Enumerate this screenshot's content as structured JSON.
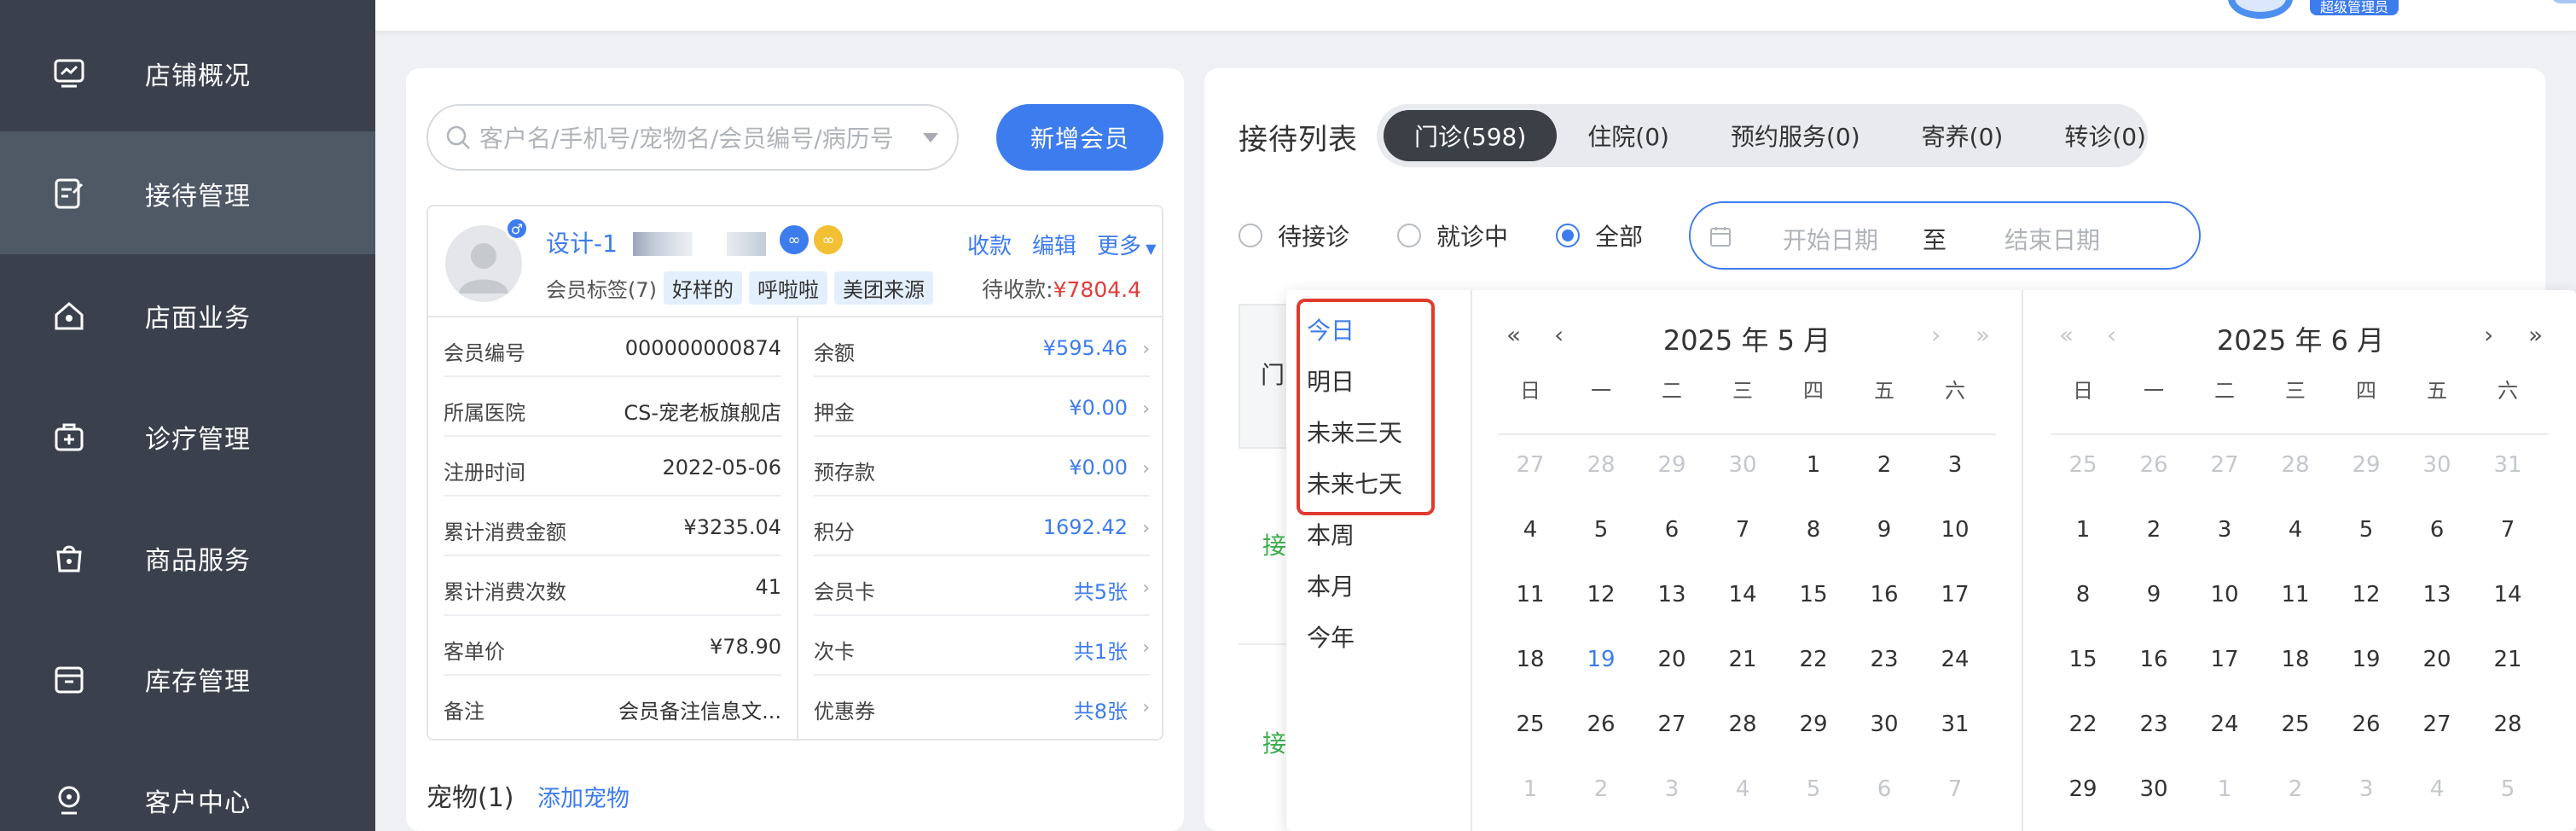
{
  "sidebar": {
    "items": [
      {
        "label": "店铺概况",
        "icon": "dashboard-icon",
        "active": false
      },
      {
        "label": "接待管理",
        "icon": "reception-icon",
        "active": true
      },
      {
        "label": "店面业务",
        "icon": "store-icon",
        "active": false
      },
      {
        "label": "诊疗管理",
        "icon": "medical-kit-icon",
        "active": false
      },
      {
        "label": "商品服务",
        "icon": "shopping-bag-icon",
        "active": false
      },
      {
        "label": "库存管理",
        "icon": "inventory-box-icon",
        "active": false
      },
      {
        "label": "客户中心",
        "icon": "customer-icon",
        "active": false
      }
    ]
  },
  "header": {
    "role_badge": "超级管理员"
  },
  "search": {
    "placeholder": "客户名/手机号/宠物名/会员编号/病历号",
    "add_member_label": "新增会员"
  },
  "member": {
    "name": "设计-1",
    "tags_label": "会员标签(7)",
    "tags": [
      "好样的",
      "呼啦啦",
      "美团来源"
    ],
    "actions": {
      "collect": "收款",
      "edit": "编辑",
      "more": "更多"
    },
    "due_label": "待收款:",
    "due_value": "¥7804.4",
    "left_rows": [
      {
        "k": "会员编号",
        "v": "000000000874"
      },
      {
        "k": "所属医院",
        "v": "CS-宠老板旗舰店"
      },
      {
        "k": "注册时间",
        "v": "2022-05-06"
      },
      {
        "k": "累计消费金额",
        "v": "¥3235.04"
      },
      {
        "k": "累计消费次数",
        "v": "41"
      },
      {
        "k": "客单价",
        "v": "¥78.90"
      },
      {
        "k": "备注",
        "v": "会员备注信息文..."
      }
    ],
    "right_rows": [
      {
        "k": "余额",
        "v": "¥595.46"
      },
      {
        "k": "押金",
        "v": "¥0.00"
      },
      {
        "k": "预存款",
        "v": "¥0.00"
      },
      {
        "k": "积分",
        "v": "1692.42"
      },
      {
        "k": "会员卡",
        "v": "共5张"
      },
      {
        "k": "次卡",
        "v": "共1张"
      },
      {
        "k": "优惠券",
        "v": "共8张"
      }
    ]
  },
  "pets": {
    "title": "宠物(1)",
    "add_label": "添加宠物"
  },
  "reception": {
    "title": "接待列表",
    "tabs": [
      {
        "label": "门诊(598)",
        "active": true
      },
      {
        "label": "住院(0)",
        "active": false
      },
      {
        "label": "预约服务(0)",
        "active": false
      },
      {
        "label": "寄养(0)",
        "active": false
      },
      {
        "label": "转诊(0)",
        "active": false
      }
    ],
    "status_filters": [
      {
        "label": "待接诊",
        "selected": false
      },
      {
        "label": "就诊中",
        "selected": false
      },
      {
        "label": "全部",
        "selected": true
      }
    ],
    "date_range": {
      "start_placeholder": "开始日期",
      "separator": "至",
      "end_placeholder": "结束日期"
    },
    "table_head_text": "门",
    "row_text": "接"
  },
  "date_picker": {
    "shortcuts": [
      "今日",
      "明日",
      "未来三天",
      "未来七天",
      "本周",
      "本月",
      "今年"
    ],
    "active_shortcut": "今日",
    "weekdays": [
      "日",
      "一",
      "二",
      "三",
      "四",
      "五",
      "六"
    ],
    "left_month": {
      "title": "2025 年 5 月",
      "days": [
        [
          27,
          28,
          29,
          30,
          1,
          2,
          3
        ],
        [
          4,
          5,
          6,
          7,
          8,
          9,
          10
        ],
        [
          11,
          12,
          13,
          14,
          15,
          16,
          17
        ],
        [
          18,
          19,
          20,
          21,
          22,
          23,
          24
        ],
        [
          25,
          26,
          27,
          28,
          29,
          30,
          31
        ],
        [
          1,
          2,
          3,
          4,
          5,
          6,
          7
        ]
      ],
      "prev_month_count": 4,
      "today": 19
    },
    "right_month": {
      "title": "2025 年 6 月",
      "days": [
        [
          25,
          26,
          27,
          28,
          29,
          30,
          31
        ],
        [
          1,
          2,
          3,
          4,
          5,
          6,
          7
        ],
        [
          8,
          9,
          10,
          11,
          12,
          13,
          14
        ],
        [
          15,
          16,
          17,
          18,
          19,
          20,
          21
        ],
        [
          22,
          23,
          24,
          25,
          26,
          27,
          28
        ],
        [
          29,
          30,
          1,
          2,
          3,
          4,
          5
        ]
      ],
      "prev_month_count": 7,
      "next_month_start_index": 37
    }
  },
  "colors": {
    "sidebar_bg": "#3a414c",
    "sidebar_active": "#4f5865",
    "accent": "#3d7cef",
    "danger": "#e23c3c",
    "highlight_box": "#e03a2e"
  }
}
